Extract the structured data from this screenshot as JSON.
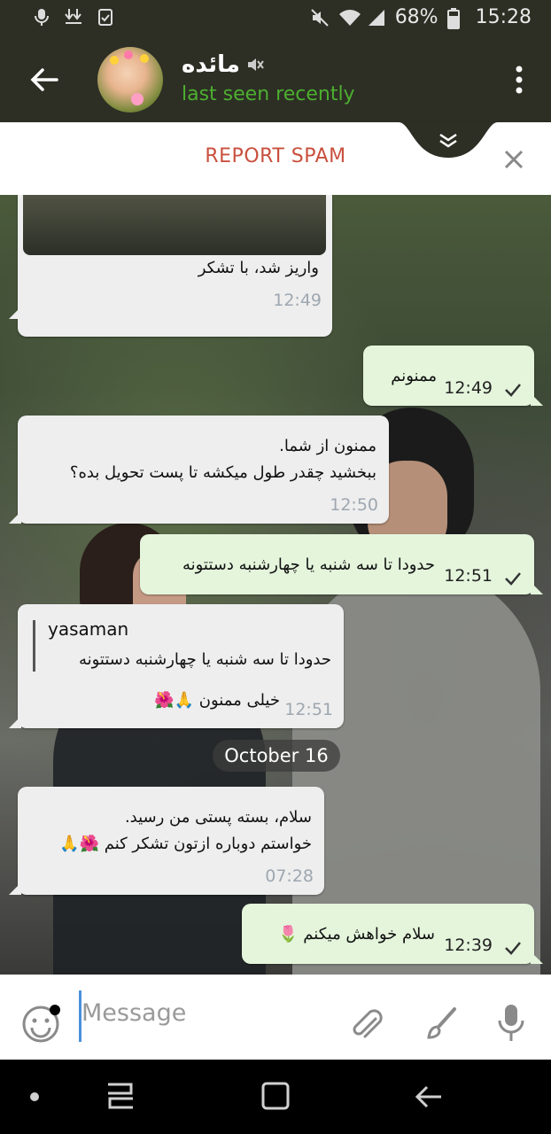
{
  "status_bar": {
    "battery": "68%",
    "time": "15:28"
  },
  "header": {
    "contact_name": "مائده",
    "status": "last seen recently"
  },
  "spam_bar": {
    "label": "REPORT SPAM"
  },
  "messages": [
    {
      "direction": "in",
      "text": "واریز شد، با تشکر",
      "time": "12:49"
    },
    {
      "direction": "out",
      "text": "ممنونم",
      "time": "12:49"
    },
    {
      "direction": "in",
      "text": "ممنون از شما.\nببخشید چقدر طول میکشه تا پست تحویل بده؟",
      "time": "12:50"
    },
    {
      "direction": "out",
      "text": "حدودا تا سه شنبه یا چهارشنبه دستتونه",
      "time": "12:51"
    },
    {
      "direction": "in",
      "reply_name": "yasaman",
      "reply_text": "حدودا تا سه شنبه یا چهارشنبه دستتونه",
      "text": "خیلی ممنون 🙏🌺",
      "time": "12:51"
    },
    {
      "direction": "in",
      "text": "سلام، بسته پستی من رسید.\nخواستم دوباره ازتون تشکر کنم 🌺🙏",
      "time": "07:28"
    },
    {
      "direction": "out",
      "text": "سلام خواهش میکنم 🌷",
      "time": "12:39"
    }
  ],
  "date_separator": "October 16",
  "input": {
    "placeholder": "Message"
  },
  "colors": {
    "header_bg": "#2d2f25",
    "online_green": "#4caf2f",
    "spam_red": "#c9503e",
    "outgoing_bubble": "#e4f5dc",
    "incoming_bubble": "#eeeeee"
  }
}
